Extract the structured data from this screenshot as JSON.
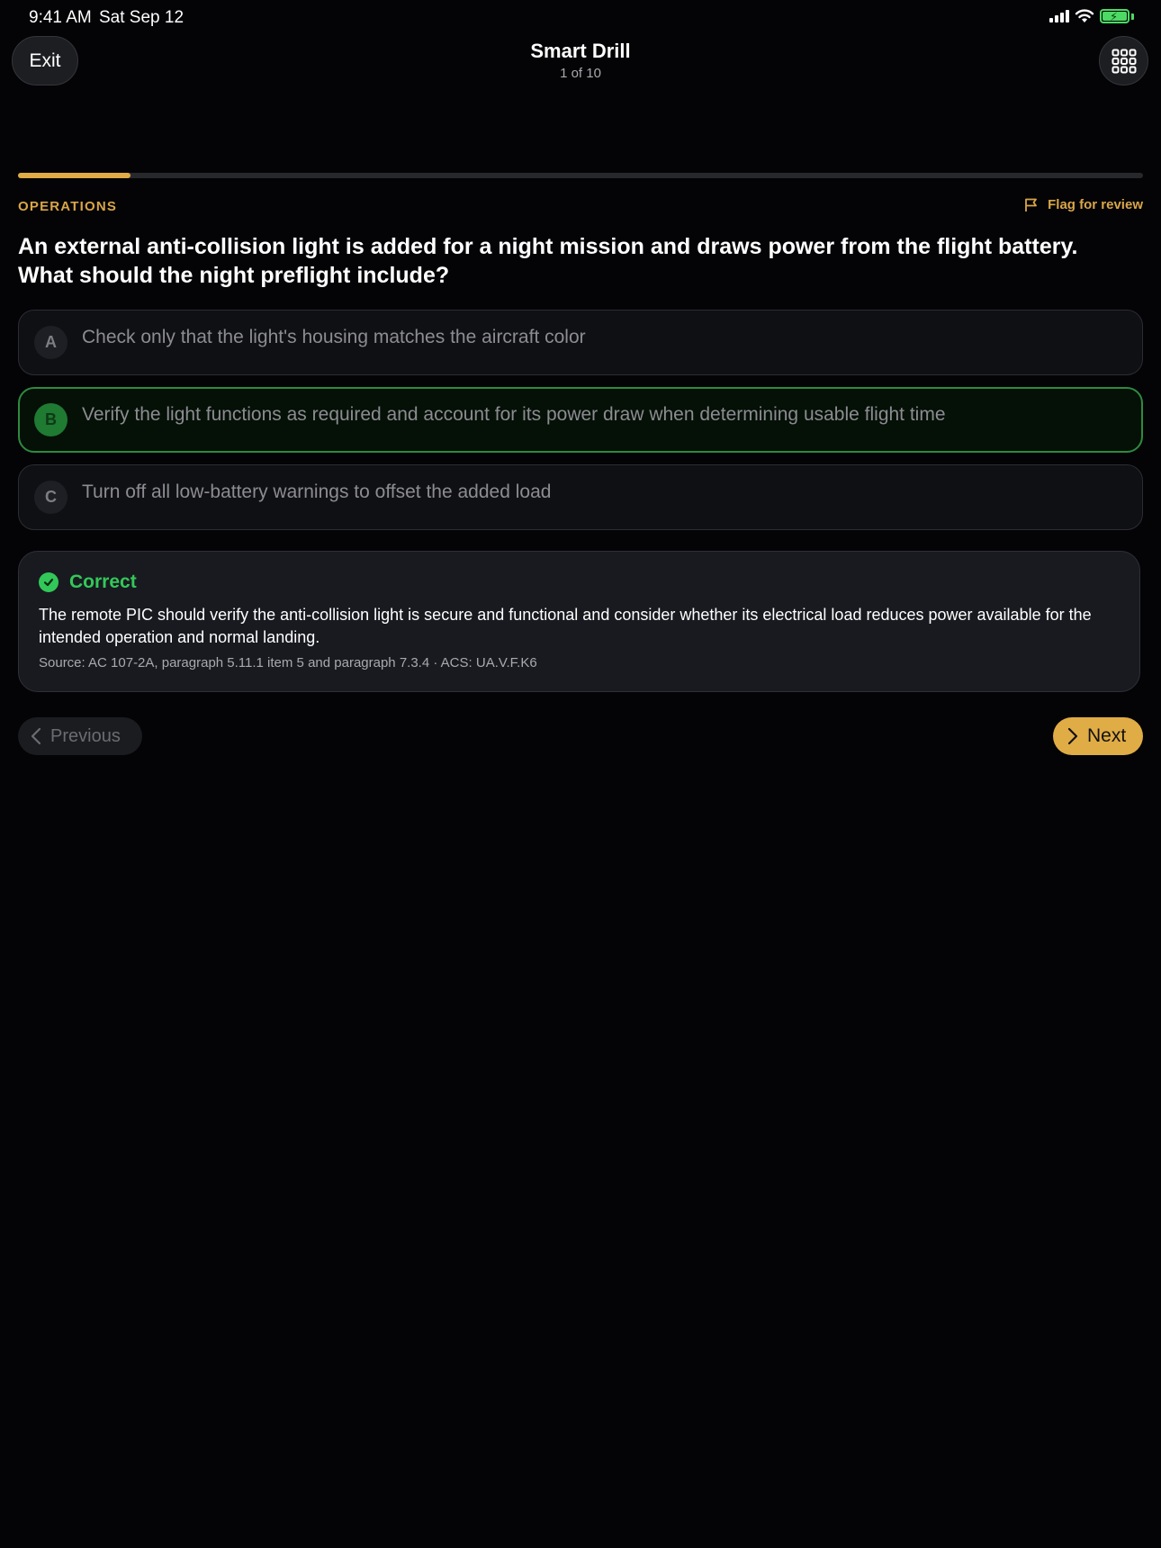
{
  "status_bar": {
    "time": "9:41 AM",
    "date": "Sat Sep 12",
    "battery_color": "#4cd964"
  },
  "header": {
    "exit_label": "Exit",
    "title": "Smart Drill",
    "subtitle": "1 of 10",
    "grid_icon": "grid-icon"
  },
  "progress": {
    "fraction": 0.1,
    "accent": "#e0ac45"
  },
  "question": {
    "category": "OPERATIONS",
    "flag_label": "Flag for review",
    "text": "An external anti-collision light is added for a night mission and draws power from the flight battery. What should the night preflight include?",
    "options": [
      {
        "letter": "A",
        "text": "Check only that the light's housing matches the aircraft color",
        "selected": false
      },
      {
        "letter": "B",
        "text": "Verify the light functions as required and account for its power draw when determining usable flight time",
        "selected": true
      },
      {
        "letter": "C",
        "text": "Turn off all low-battery warnings to offset the added load",
        "selected": false
      }
    ]
  },
  "feedback": {
    "status": "Correct",
    "status_color": "#34c759",
    "explanation": "The remote PIC should verify the anti-collision light is secure and functional and consider whether its electrical load reduces power available for the intended operation and normal landing.",
    "source": "Source: AC 107-2A, paragraph 5.11.1 item 5 and paragraph 7.3.4 · ACS: UA.V.F.K6"
  },
  "nav": {
    "previous_label": "Previous",
    "next_label": "Next"
  }
}
